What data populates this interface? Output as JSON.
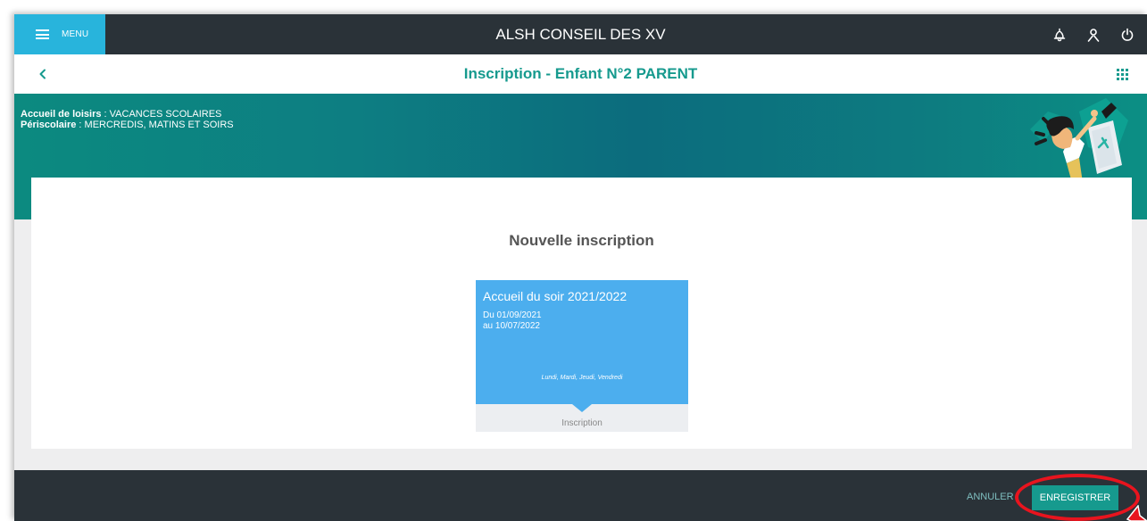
{
  "topbar": {
    "menu_label": "MENU",
    "app_title": "ALSH CONSEIL DES XV",
    "icons": [
      "bell-icon",
      "user-icon",
      "power-icon"
    ]
  },
  "subheader": {
    "title": "Inscription  -  Enfant N°2 PARENT",
    "icons": [
      "back-arrow-icon",
      "apps-grid-icon"
    ]
  },
  "banner": {
    "line1_label": "Accueil de loisirs",
    "line1_value": " : VACANCES SCOLAIRES",
    "line2_label": "Périscolaire",
    "line2_value": " : MERCREDIS, MATINS ET SOIRS"
  },
  "main": {
    "section_title": "Nouvelle inscription",
    "tile": {
      "name": "Accueil du soir 2021/2022",
      "date_from": "Du 01/09/2021",
      "date_to": "au 10/07/2022",
      "days": "Lundi, Mardi, Jeudi, Vendredi",
      "action": "Inscription"
    }
  },
  "footer": {
    "cancel_label": "ANNULER",
    "save_label": "ENREGISTRER"
  },
  "colors": {
    "topbar_bg": "#2a3238",
    "menu_bg": "#28b4dc",
    "accent_teal": "#169a8e",
    "tile_blue": "#4caeee",
    "highlight_red": "#e8141e"
  }
}
